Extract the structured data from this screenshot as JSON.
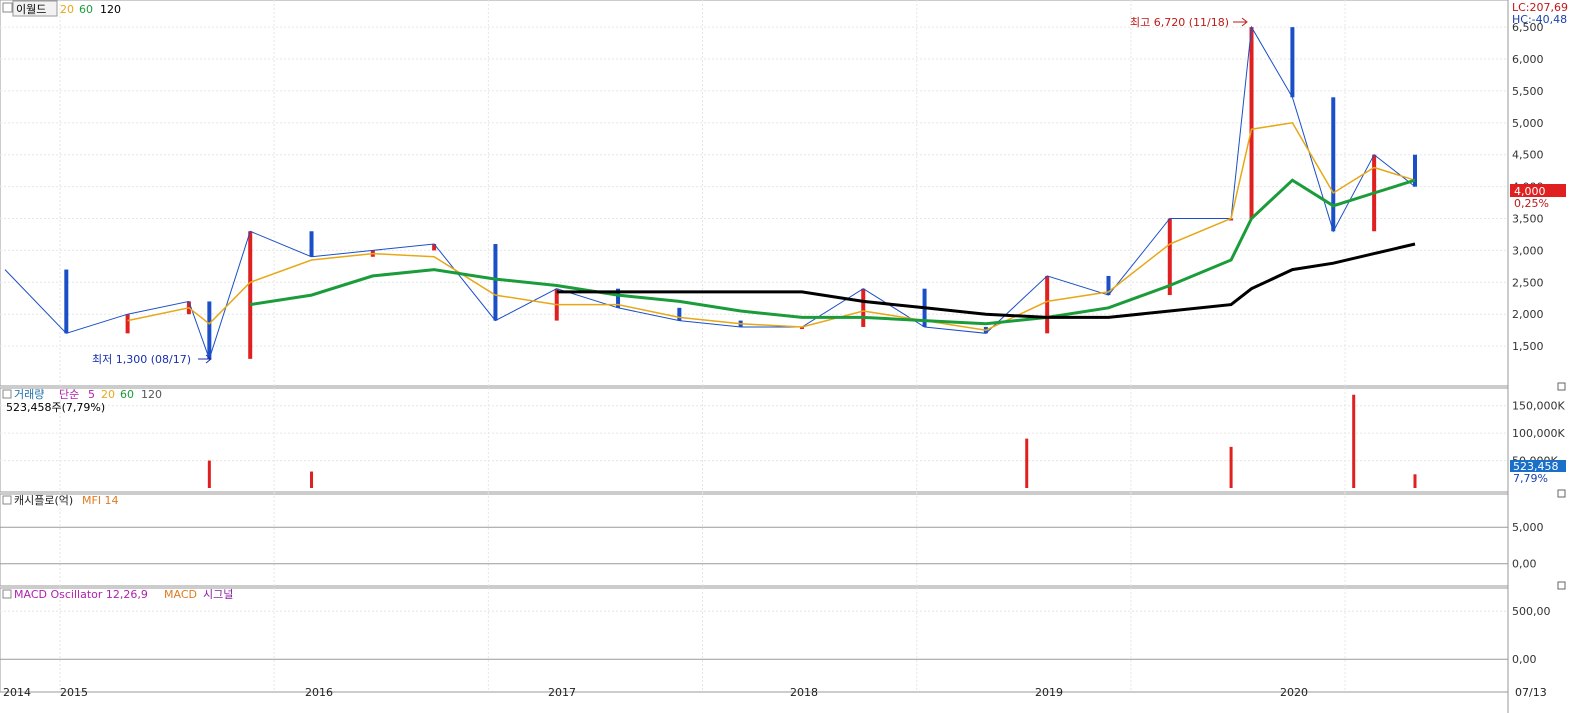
{
  "header": {
    "stock_name": "이월드",
    "ma_labels": [
      {
        "text": "20",
        "color": "#e6a817"
      },
      {
        "text": "60",
        "color": "#1a9c3a"
      },
      {
        "text": "120",
        "color": "#000000"
      }
    ],
    "lc_text": "LC:207,69",
    "hc_text": "HC:-40,48",
    "current_price_label": "4,000",
    "current_change_label": "0,25%"
  },
  "annotations": {
    "max_label": "최고 6,720 (11/18)",
    "min_label": "최저 1,300 (08/17)"
  },
  "price_axis": [
    "6,500",
    "6,000",
    "5,500",
    "5,000",
    "4,500",
    "4,000",
    "3,500",
    "3,000",
    "2,500",
    "2,000",
    "1,500"
  ],
  "volume_panel": {
    "title_parts": [
      {
        "text": "거래량",
        "color": "#1a6fa8"
      },
      {
        "text": "단순",
        "color": "#b01fb0"
      },
      {
        "text": "5",
        "color": "#b01fb0"
      },
      {
        "text": "20",
        "color": "#e6a817"
      },
      {
        "text": "60",
        "color": "#1a9c3a"
      },
      {
        "text": "120",
        "color": "#555555"
      }
    ],
    "subtitle": "523,458주(7,79%)",
    "axis": [
      "150,000K",
      "100,000K",
      "50,000K"
    ],
    "current_label": "523,458",
    "current_pct": "7,79%"
  },
  "mfi_panel": {
    "title_parts": [
      {
        "text": "캐시플로(억)",
        "color": "#222222"
      },
      {
        "text": "MFI 14",
        "color": "#e07a20"
      }
    ],
    "axis": [
      "5,000",
      "0,00"
    ]
  },
  "macd_panel": {
    "title_parts": [
      {
        "text": "MACD Oscillator 12,26,9",
        "color": "#b01fb0"
      },
      {
        "text": "MACD",
        "color": "#e07a20"
      },
      {
        "text": "시그널",
        "color": "#8a1fa0"
      }
    ],
    "axis": [
      "500,00",
      "0,00"
    ]
  },
  "time_axis": [
    "2014",
    "2015",
    "2016",
    "2017",
    "2018",
    "2019",
    "2020",
    "07/13"
  ],
  "chart_data": {
    "type": "line",
    "title": "이월드",
    "x": [
      "2014-10",
      "2015-01",
      "2015-04",
      "2015-07",
      "2015-08",
      "2015-10",
      "2016-01",
      "2016-04",
      "2016-07",
      "2016-10",
      "2017-01",
      "2017-04",
      "2017-07",
      "2017-10",
      "2018-01",
      "2018-04",
      "2018-07",
      "2018-10",
      "2019-01",
      "2019-04",
      "2019-07",
      "2019-10",
      "2019-11",
      "2020-01",
      "2020-03",
      "2020-05",
      "2020-07"
    ],
    "series": [
      {
        "name": "이월드",
        "values": [
          2700,
          1700,
          2000,
          2200,
          1300,
          3300,
          2900,
          3000,
          3100,
          1900,
          2400,
          2100,
          1900,
          1800,
          1800,
          2400,
          1800,
          1700,
          2600,
          2300,
          3500,
          3500,
          6500,
          5400,
          3300,
          4500,
          4000
        ]
      },
      {
        "name": "20",
        "values": [
          null,
          null,
          1900,
          2100,
          1850,
          2500,
          2850,
          2950,
          2900,
          2300,
          2150,
          2150,
          1950,
          1850,
          1800,
          2050,
          1900,
          1750,
          2200,
          2350,
          3100,
          3500,
          4900,
          5000,
          3900,
          4300,
          4100
        ]
      },
      {
        "name": "60",
        "values": [
          null,
          null,
          null,
          null,
          null,
          2150,
          2300,
          2600,
          2700,
          2550,
          2450,
          2300,
          2200,
          2050,
          1950,
          1950,
          1900,
          1850,
          1950,
          2100,
          2450,
          2850,
          3500,
          4100,
          3700,
          3900,
          4100
        ]
      },
      {
        "name": "120",
        "values": [
          null,
          null,
          null,
          null,
          null,
          null,
          null,
          null,
          null,
          null,
          2350,
          2350,
          2350,
          2350,
          2350,
          2200,
          2100,
          2000,
          1950,
          1950,
          2050,
          2150,
          2400,
          2700,
          2800,
          2950,
          3100
        ]
      }
    ],
    "ylim": [
      1000,
      6800
    ],
    "y_ticks": [
      1500,
      2000,
      2500,
      3000,
      3500,
      4000,
      4500,
      5000,
      5500,
      6000,
      6500
    ],
    "current_price": 4000,
    "high": 6720,
    "low": 1300,
    "volume_ylim": [
      0,
      175000
    ],
    "volume_ticks": [
      50000,
      100000,
      150000
    ],
    "volume_series": [
      {
        "x": "2015-08",
        "value": 50000
      },
      {
        "x": "2016-01",
        "value": 30000
      },
      {
        "x": "2018-12",
        "value": 90000
      },
      {
        "x": "2019-10",
        "value": 75000
      },
      {
        "x": "2020-04",
        "value": 170000
      },
      {
        "x": "2020-07",
        "value": 25000
      }
    ],
    "mfi_ylim": [
      -2500,
      9000
    ],
    "macd_ylim": [
      -300,
      700
    ]
  }
}
